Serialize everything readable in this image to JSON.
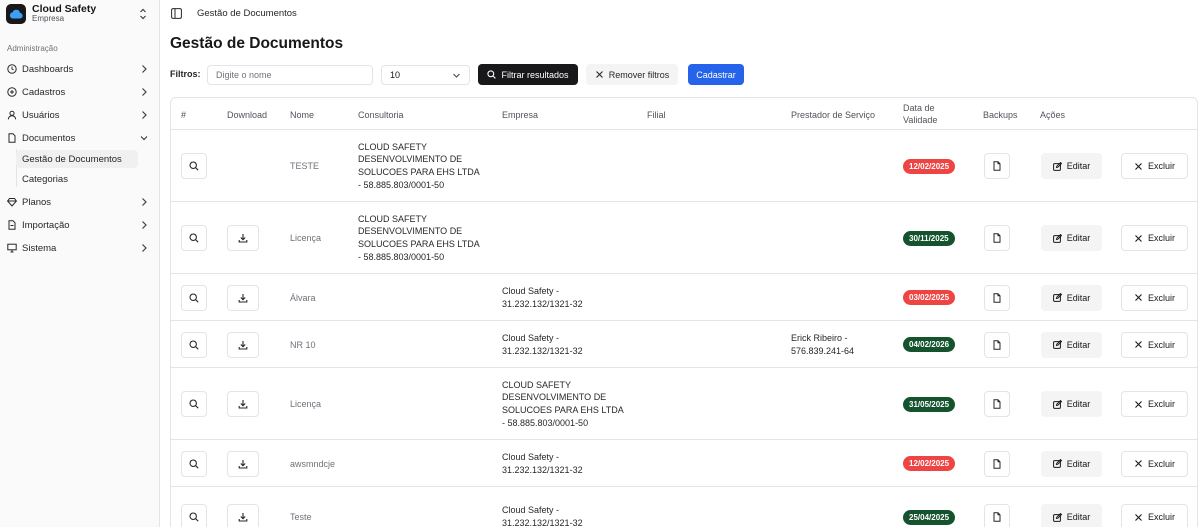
{
  "brand": {
    "name": "Cloud Safety",
    "subtitle": "Empresa"
  },
  "sidebar": {
    "section_label": "Administração",
    "items": [
      {
        "label": "Dashboards",
        "icon": "clock-icon"
      },
      {
        "label": "Cadastros",
        "icon": "plus-circle-icon"
      },
      {
        "label": "Usuários",
        "icon": "user-icon"
      },
      {
        "label": "Documentos",
        "icon": "file-icon"
      },
      {
        "label": "Planos",
        "icon": "gem-icon"
      },
      {
        "label": "Importação",
        "icon": "file-import-icon"
      },
      {
        "label": "Sistema",
        "icon": "monitor-icon"
      }
    ],
    "sub_items": [
      {
        "label": "Gestão de Documentos",
        "active": true
      },
      {
        "label": "Categorias",
        "active": false
      }
    ]
  },
  "header": {
    "breadcrumb": "Gestão de Documentos"
  },
  "page": {
    "title": "Gestão de Documentos"
  },
  "filters": {
    "label": "Filtros:",
    "search_placeholder": "Digite o nome",
    "page_size": "10",
    "filter_button": "Filtrar resultados",
    "clear_button": "Remover filtros",
    "create_button": "Cadastrar"
  },
  "table": {
    "columns": {
      "index": "#",
      "download": "Download",
      "name": "Nome",
      "consultoria": "Consultoria",
      "empresa": "Empresa",
      "filial": "Filial",
      "prestador": "Prestador de Serviço",
      "validade_1": "Data de",
      "validade_2": "Validade",
      "backups": "Backups",
      "acoes": "Ações"
    },
    "edit_label": "Editar",
    "delete_label": "Excluir",
    "rows": [
      {
        "name": "TESTE",
        "download": false,
        "consultoria": [
          "CLOUD SAFETY",
          "DESENVOLVIMENTO DE",
          "SOLUCOES PARA EHS LTDA",
          "- 58.885.803/0001-50"
        ],
        "empresa": [],
        "prestador": [],
        "validade": "12/02/2025",
        "status": "red"
      },
      {
        "name": "Licença",
        "download": true,
        "consultoria": [
          "CLOUD SAFETY",
          "DESENVOLVIMENTO DE",
          "SOLUCOES PARA EHS LTDA",
          "- 58.885.803/0001-50"
        ],
        "empresa": [],
        "prestador": [],
        "validade": "30/11/2025",
        "status": "green"
      },
      {
        "name": "Álvara",
        "download": true,
        "consultoria": [],
        "empresa": [
          "Cloud Safety -",
          "31.232.132/1321-32"
        ],
        "prestador": [],
        "validade": "03/02/2025",
        "status": "red"
      },
      {
        "name": "NR 10",
        "download": true,
        "consultoria": [],
        "empresa": [
          "Cloud Safety -",
          "31.232.132/1321-32"
        ],
        "prestador": [
          "Erick Ribeiro -",
          "576.839.241-64"
        ],
        "validade": "04/02/2026",
        "status": "green"
      },
      {
        "name": "Licença",
        "download": true,
        "consultoria": [],
        "empresa": [
          "CLOUD SAFETY",
          "DESENVOLVIMENTO DE",
          "SOLUCOES PARA EHS LTDA",
          "- 58.885.803/0001-50"
        ],
        "prestador": [],
        "validade": "31/05/2025",
        "status": "green"
      },
      {
        "name": "awsmndcje",
        "download": true,
        "consultoria": [],
        "empresa": [
          "Cloud Safety -",
          "31.232.132/1321-32"
        ],
        "prestador": [],
        "validade": "12/02/2025",
        "status": "red"
      },
      {
        "name": "Teste",
        "download": true,
        "consultoria": [],
        "empresa": [
          "Cloud Safety -",
          "31.232.132/1321-32"
        ],
        "prestador": [],
        "validade": "25/04/2025",
        "status": "green"
      }
    ]
  },
  "colors": {
    "red": "#ef4444",
    "green": "#14532d",
    "primary": "#2563eb",
    "dark": "#18181b"
  }
}
